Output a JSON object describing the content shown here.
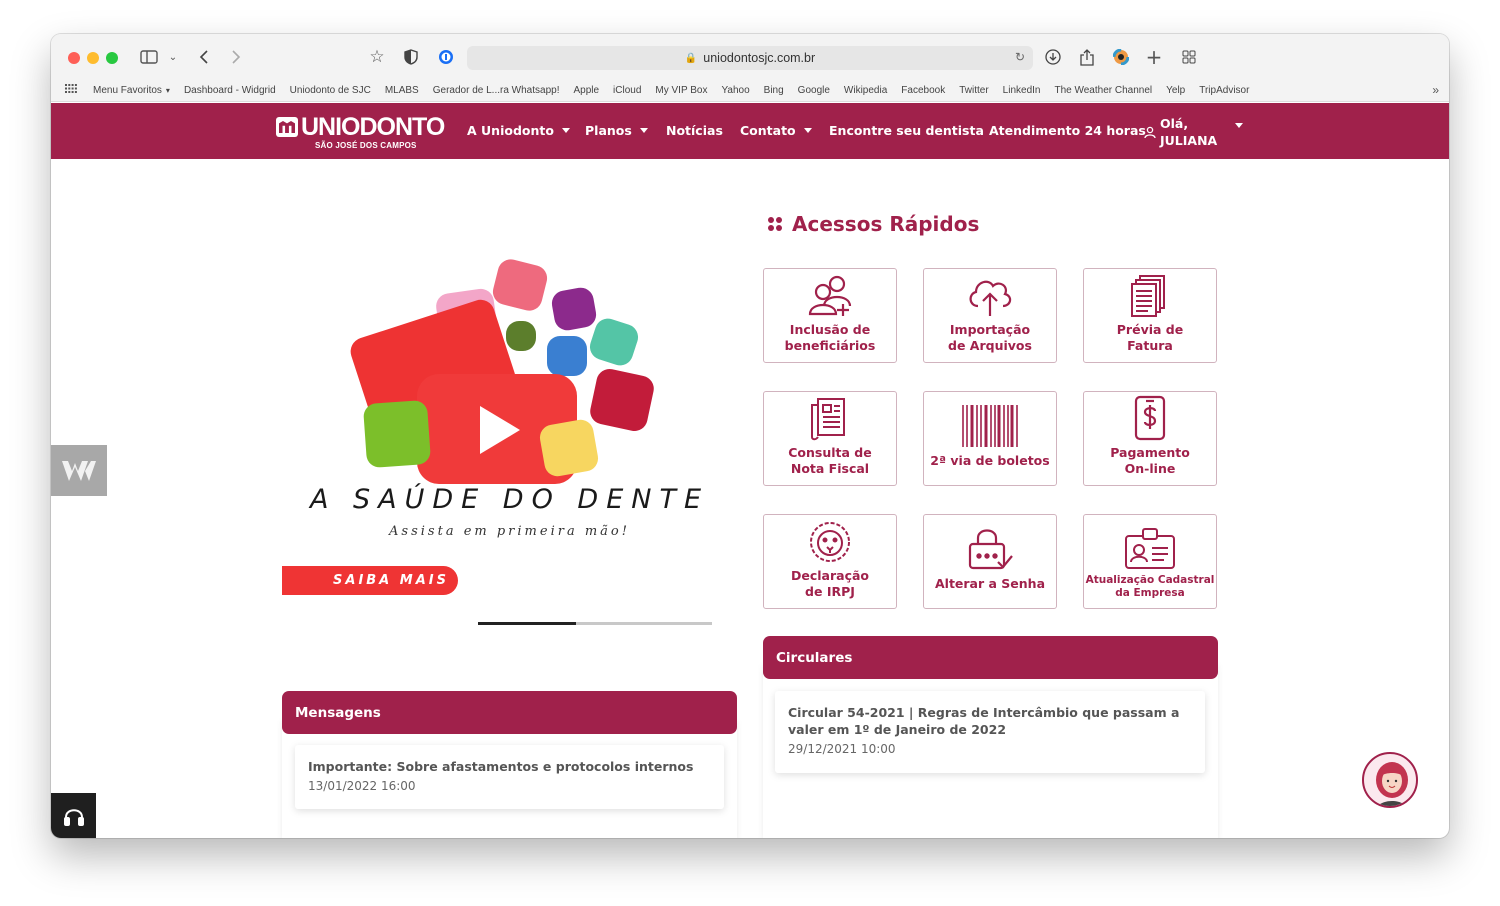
{
  "browser": {
    "url": "uniodontosjc.com.br",
    "bookmarks": [
      "Menu Favoritos",
      "Dashboard - Widgrid",
      "Uniodonto de SJC",
      "MLABS",
      "Gerador de L...ra Whatsapp!",
      "Apple",
      "iCloud",
      "My VIP Box",
      "Yahoo",
      "Bing",
      "Google",
      "Wikipedia",
      "Facebook",
      "Twitter",
      "LinkedIn",
      "The Weather Channel",
      "Yelp",
      "TripAdvisor"
    ],
    "more": "»"
  },
  "nav": {
    "logo_main": "UNIODONTO",
    "logo_sub": "SÃO JOSÉ DOS CAMPOS",
    "items": [
      "A Uniodonto",
      "Planos",
      "Notícias",
      "Contato",
      "Encontre seu dentista",
      "Atendimento 24 horas"
    ],
    "greeting": "Olá,",
    "user_name": "JULIANA"
  },
  "hero": {
    "title": "A SAÚDE DO DENTE",
    "subtitle": "Assista em primeira mão!",
    "cta": "SAIBA MAIS",
    "progress": 0.42
  },
  "quick_access": {
    "title": "Acessos Rápidos",
    "items": [
      {
        "label1": "Inclusão de",
        "label2": "beneficiários",
        "icon": "add-user-icon"
      },
      {
        "label1": "Importação",
        "label2": "de Arquivos",
        "icon": "cloud-upload-icon"
      },
      {
        "label1": "Prévia de",
        "label2": "Fatura",
        "icon": "document-stack-icon"
      },
      {
        "label1": "Consulta de",
        "label2": "Nota Fiscal",
        "icon": "newspaper-icon"
      },
      {
        "label1": "2ª via de boletos",
        "label2": "",
        "icon": "barcode-icon"
      },
      {
        "label1": "Pagamento",
        "label2": "On-line",
        "icon": "mobile-payment-icon"
      },
      {
        "label1": "Declaração",
        "label2": "de IRPJ",
        "icon": "lion-icon"
      },
      {
        "label1": "Alterar a Senha",
        "label2": "",
        "icon": "password-lock-icon"
      },
      {
        "label1": "Atualização Cadastral",
        "label2": "da Empresa",
        "icon": "id-card-icon"
      }
    ]
  },
  "mensagens": {
    "title": "Mensagens",
    "items": [
      {
        "title": "Importante: Sobre afastamentos e protocolos internos",
        "date": "13/01/2022 16:00"
      }
    ]
  },
  "circulares": {
    "title": "Circulares",
    "items": [
      {
        "title": "Circular 54-2021 | Regras de Intercâmbio que passam a valer em 1º de Janeiro de 2022",
        "date": "29/12/2021 10:00"
      }
    ]
  },
  "colors": {
    "brand": "#a0214b",
    "cta": "#ef3434"
  }
}
